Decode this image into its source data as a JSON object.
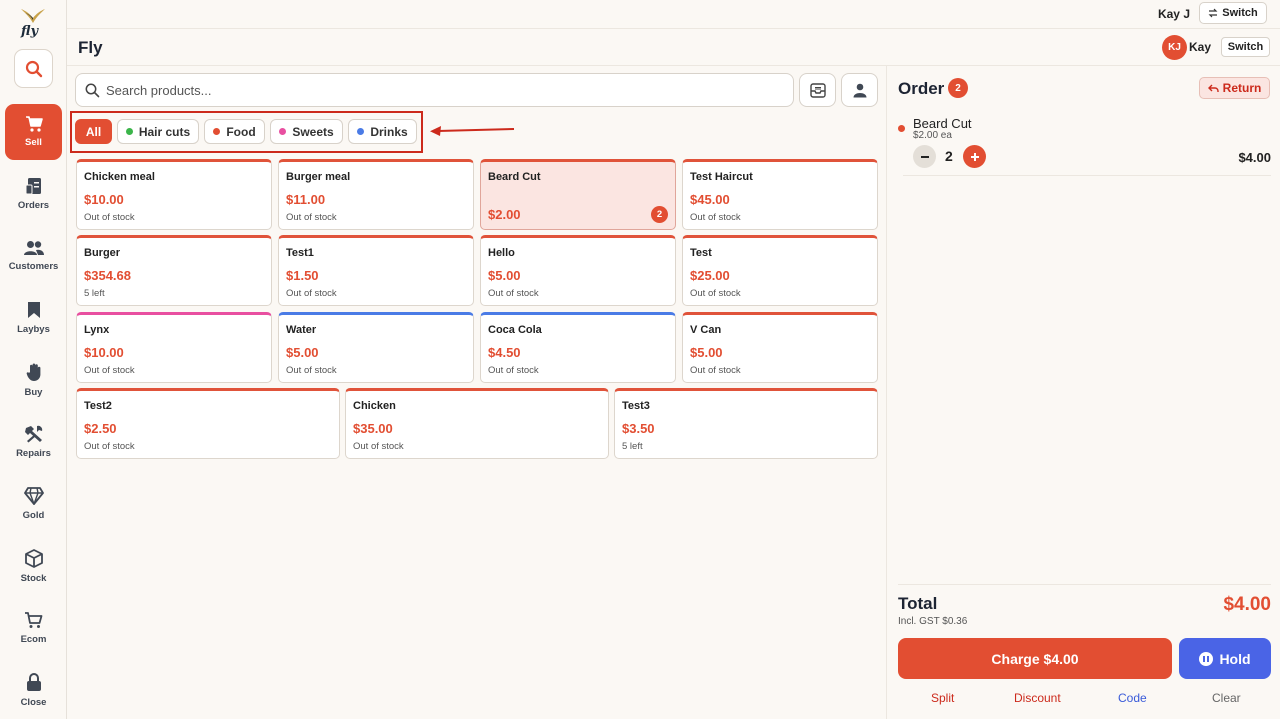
{
  "app": {
    "logo_text": "fly",
    "title": "Fly"
  },
  "topbar": {
    "user": "Kay J",
    "switch_label": "Switch"
  },
  "header": {
    "avatar_initials": "KJ",
    "user": "Kay",
    "switch_label": "Switch"
  },
  "sidebar": {
    "items": [
      {
        "label": "Sell",
        "icon": "cart-icon",
        "active": true
      },
      {
        "label": "Orders",
        "icon": "orders-icon"
      },
      {
        "label": "Customers",
        "icon": "customers-icon"
      },
      {
        "label": "Laybys",
        "icon": "bookmark-icon"
      },
      {
        "label": "Buy",
        "icon": "hand-icon"
      },
      {
        "label": "Repairs",
        "icon": "tools-icon"
      },
      {
        "label": "Gold",
        "icon": "diamond-icon"
      },
      {
        "label": "Stock",
        "icon": "box-icon"
      },
      {
        "label": "Ecom",
        "icon": "cart-outline-icon"
      },
      {
        "label": "Close",
        "icon": "lock-icon"
      }
    ]
  },
  "search": {
    "placeholder": "Search products..."
  },
  "categories": [
    {
      "label": "All",
      "active": true,
      "color": ""
    },
    {
      "label": "Hair cuts",
      "color": "#3bb54a"
    },
    {
      "label": "Food",
      "color": "#e24e32"
    },
    {
      "label": "Sweets",
      "color": "#e84fa0"
    },
    {
      "label": "Drinks",
      "color": "#4a7be6"
    }
  ],
  "products": [
    {
      "name": "Chicken meal",
      "price": "$10.00",
      "stock": "Out of stock",
      "color": "#e0533a"
    },
    {
      "name": "Burger meal",
      "price": "$11.00",
      "stock": "Out of stock",
      "color": "#e0533a"
    },
    {
      "name": "Beard Cut",
      "price": "$2.00",
      "stock": "",
      "color": "#e0533a",
      "selected": true,
      "qty": "2"
    },
    {
      "name": "Test Haircut",
      "price": "$45.00",
      "stock": "Out of stock",
      "color": "#e0533a"
    },
    {
      "name": "Burger",
      "price": "$354.68",
      "stock": "5 left",
      "color": "#e0533a"
    },
    {
      "name": "Test1",
      "price": "$1.50",
      "stock": "Out of stock",
      "color": "#e0533a"
    },
    {
      "name": "Hello",
      "price": "$5.00",
      "stock": "Out of stock",
      "color": "#e0533a"
    },
    {
      "name": "Test",
      "price": "$25.00",
      "stock": "Out of stock",
      "color": "#e0533a"
    },
    {
      "name": "Lynx",
      "price": "$10.00",
      "stock": "Out of stock",
      "color": "#e84fa0"
    },
    {
      "name": "Water",
      "price": "$5.00",
      "stock": "Out of stock",
      "color": "#4a7be6"
    },
    {
      "name": "Coca Cola",
      "price": "$4.50",
      "stock": "Out of stock",
      "color": "#4a7be6"
    },
    {
      "name": "V Can",
      "price": "$5.00",
      "stock": "Out of stock",
      "color": "#e0533a"
    },
    {
      "name": "Test2",
      "price": "$2.50",
      "stock": "Out of stock",
      "color": "#e0533a"
    },
    {
      "name": "Chicken",
      "price": "$35.00",
      "stock": "Out of stock",
      "color": "#e0533a"
    },
    {
      "name": "Test3",
      "price": "$3.50",
      "stock": "5 left",
      "color": "#e0533a"
    }
  ],
  "order": {
    "title": "Order",
    "count": "2",
    "return_label": "Return",
    "items": [
      {
        "name": "Beard Cut",
        "each": "$2.00 ea",
        "qty": "2",
        "total": "$4.00"
      }
    ],
    "total_label": "Total",
    "gst_label": "Incl. GST $0.36",
    "total_value": "$4.00",
    "charge_label": "Charge $4.00",
    "hold_label": "Hold",
    "links": [
      {
        "label": "Split",
        "color": "#cc2a1c"
      },
      {
        "label": "Discount",
        "color": "#cc2a1c"
      },
      {
        "label": "Code",
        "color": "#3a5bd9"
      },
      {
        "label": "Clear",
        "color": "#666666"
      }
    ]
  },
  "colors": {
    "accent": "#e24e32",
    "hold": "#4a64e6",
    "highlight_frame": "#cc2a1c"
  }
}
